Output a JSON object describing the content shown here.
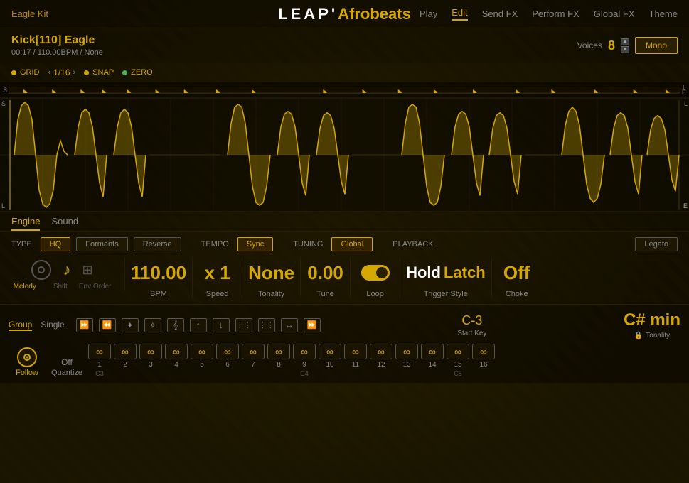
{
  "app": {
    "name": "Eagle Kit",
    "logo_leap": "LEAP",
    "logo_subtitle": "Afrobeats",
    "apostrophe": "'"
  },
  "nav": {
    "items": [
      {
        "label": "Play",
        "active": false
      },
      {
        "label": "Edit",
        "active": true
      },
      {
        "label": "Send FX",
        "active": false
      },
      {
        "label": "Perform FX",
        "active": false
      },
      {
        "label": "Global FX",
        "active": false
      },
      {
        "label": "Theme",
        "active": false
      }
    ]
  },
  "instrument": {
    "name": "Kick[110] Eagle",
    "time": "00:17",
    "bpm": "110.00BPM",
    "key": "None",
    "voices_label": "Voices",
    "voices_value": "8",
    "mono_label": "Mono"
  },
  "grid": {
    "grid_label": "GRID",
    "grid_value": "1/16",
    "snap_label": "SNAP",
    "zero_label": "ZERO"
  },
  "waveform": {
    "s_label": "S",
    "l_label_top": "L",
    "l_label_bottom": "L",
    "e_label_top": "E",
    "e_label_bottom": "E"
  },
  "tabs": {
    "engine_label": "Engine",
    "sound_label": "Sound"
  },
  "engine": {
    "type_label": "TYPE",
    "hq_label": "HQ",
    "formants_label": "Formants",
    "reverse_label": "Reverse",
    "tempo_label": "TEMPO",
    "sync_label": "Sync",
    "bpm_value": "110.00",
    "bpm_label": "BPM",
    "speed_value": "x 1",
    "speed_label": "Speed",
    "tuning_label": "TUNING",
    "global_label": "Global",
    "tonality_value": "None",
    "tonality_label": "Tonality",
    "tune_value": "0.00",
    "tune_label": "Tune",
    "playback_label": "PLAYBACK",
    "loop_label": "Loop",
    "trigger_hold": "Hold",
    "trigger_latch": "Latch",
    "trigger_label": "Trigger Style",
    "choke_value": "Off",
    "choke_label": "Choke",
    "legato_label": "Legato",
    "melody_label": "Melody",
    "shift_label": "Shift",
    "env_order_label": "Env Order"
  },
  "sequencer": {
    "group_label": "Group",
    "single_label": "Single",
    "follow_label": "Follow",
    "quantize_value": "Off",
    "quantize_label": "Quantize",
    "start_key_value": "C-3",
    "start_key_label": "Start Key",
    "tonality_value": "C# min",
    "tonality_label": "Tonality",
    "steps": [
      {
        "num": "1",
        "note": "C3",
        "active": true
      },
      {
        "num": "2",
        "note": "",
        "active": true
      },
      {
        "num": "3",
        "note": "",
        "active": true
      },
      {
        "num": "4",
        "note": "",
        "active": true
      },
      {
        "num": "5",
        "note": "",
        "active": true
      },
      {
        "num": "6",
        "note": "",
        "active": true
      },
      {
        "num": "7",
        "note": "",
        "active": true
      },
      {
        "num": "8",
        "note": "",
        "active": true
      },
      {
        "num": "9",
        "note": "C4",
        "active": true
      },
      {
        "num": "10",
        "note": "",
        "active": true
      },
      {
        "num": "11",
        "note": "",
        "active": true
      },
      {
        "num": "12",
        "note": "",
        "active": true
      },
      {
        "num": "13",
        "note": "",
        "active": true
      },
      {
        "num": "14",
        "note": "",
        "active": true
      },
      {
        "num": "15",
        "note": "C5",
        "active": true
      },
      {
        "num": "16",
        "note": "",
        "active": true
      }
    ],
    "octave_labels": [
      "C3",
      "",
      "",
      "",
      "",
      "",
      "",
      "C4",
      "",
      "",
      "",
      "",
      "",
      "",
      "C5",
      ""
    ],
    "tools": [
      "⏩",
      "⏪",
      "✦",
      "✧",
      "𝄞",
      "↑",
      "↓",
      "⋮⋮",
      "⋮⋮",
      "↔",
      "⏩"
    ]
  }
}
